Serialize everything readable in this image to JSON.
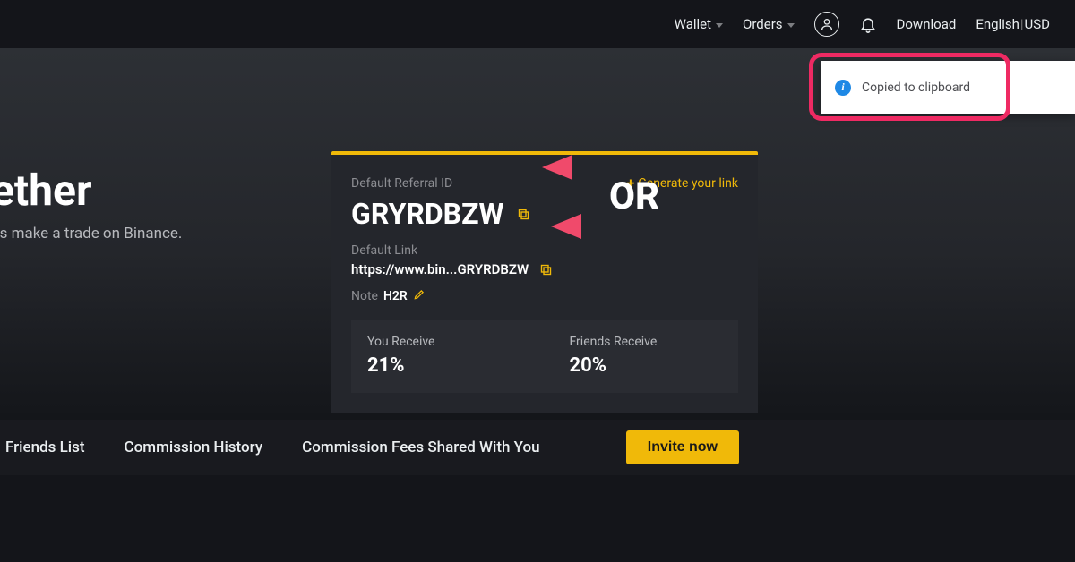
{
  "nav": {
    "wallet": "Wallet",
    "orders": "Orders",
    "download": "Download",
    "language": "English",
    "currency": "USD"
  },
  "hero": {
    "title_fragment": "ether",
    "sub_fragment": "ds make a trade on Binance."
  },
  "card": {
    "label_referral_id": "Default Referral ID",
    "generate_link": "Generate your link",
    "referral_id": "GRYRDBZW",
    "label_default_link": "Default Link",
    "default_link": "https://www.bin...GRYRDBZW",
    "note_label": "Note",
    "note_value": "H2R",
    "you_receive_label": "You Receive",
    "you_receive_value": "21%",
    "friends_receive_label": "Friends Receive",
    "friends_receive_value": "20%"
  },
  "tabs": {
    "friends_list": "Friends List",
    "commission_history": "Commission History",
    "commission_shared": "Commission Fees Shared With You",
    "invite_now": "Invite now"
  },
  "toast": {
    "message": "Copied to clipboard"
  },
  "annotation": {
    "or": "OR"
  }
}
